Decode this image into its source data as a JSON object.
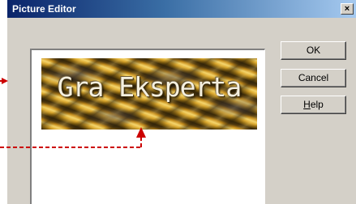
{
  "window": {
    "title": "Picture Editor",
    "close_glyph": "×"
  },
  "preview": {
    "image_text": "Gra Eksperta"
  },
  "buttons": {
    "ok_label": "OK",
    "cancel_label": "Cancel",
    "help_mnemonic": "H",
    "help_rest": "elp"
  },
  "annotations": {
    "arrow_color": "#cc0000",
    "icons": [
      "arrow-head-icon",
      "arrow-head-icon"
    ]
  },
  "colors": {
    "titlebar_start": "#0a246a",
    "titlebar_end": "#a6caf0",
    "dialog_face": "#d4d0c8"
  }
}
